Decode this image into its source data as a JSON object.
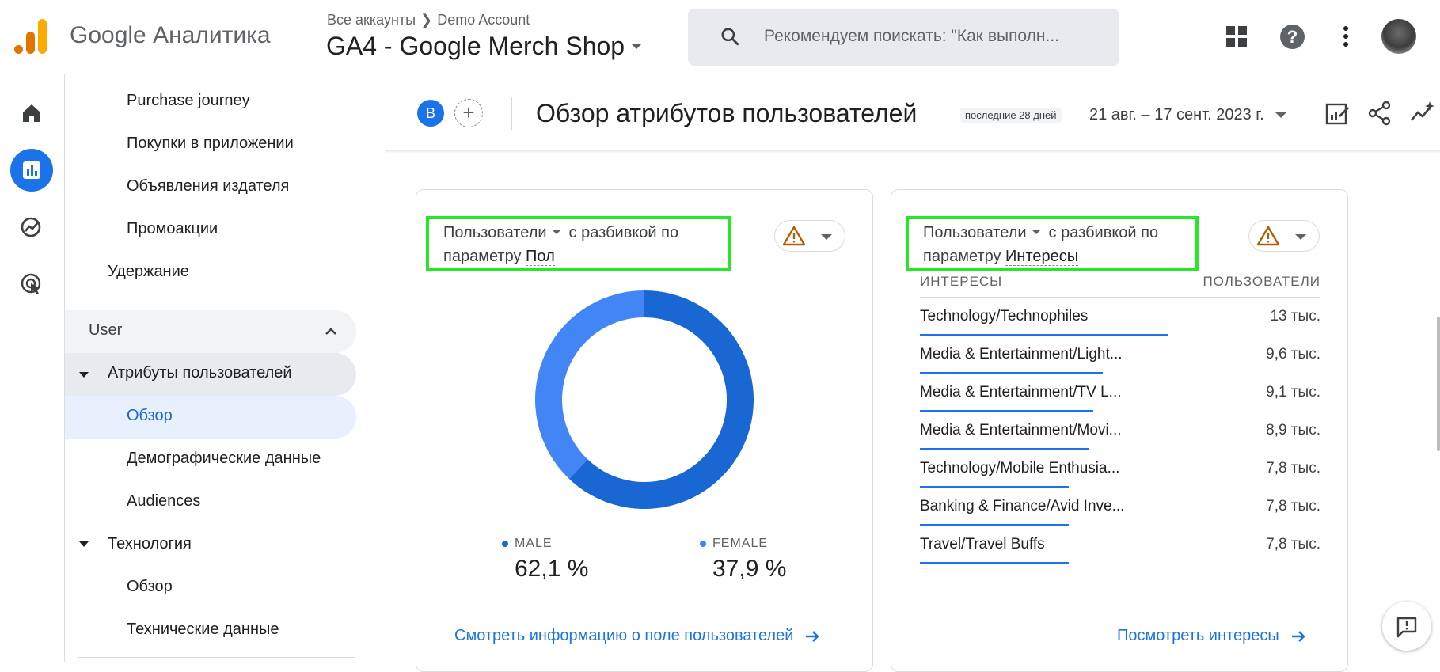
{
  "header": {
    "app_name": "Google Аналитика",
    "breadcrumb_root": "Все аккаунты",
    "breadcrumb_account": "Demo Account",
    "property_name": "GA4 - Google Merch Shop",
    "search_placeholder": "Рекомендуем поискать: \"Как выполн...",
    "icons": [
      "apps-icon",
      "help-icon",
      "more-vert-icon",
      "avatar"
    ]
  },
  "rail": {
    "items": [
      "home-icon",
      "reports-icon",
      "explore-icon",
      "advertising-icon"
    ],
    "active": "reports-icon"
  },
  "nav": {
    "items": [
      {
        "label": "Purchase journey"
      },
      {
        "label": "Покупки в приложении"
      },
      {
        "label": "Объявления издателя"
      },
      {
        "label": "Промоакции"
      },
      {
        "label": "Удержание"
      },
      {
        "label": "User"
      },
      {
        "label": "Атрибуты пользователей"
      },
      {
        "label": "Обзор"
      },
      {
        "label": "Демографические данные"
      },
      {
        "label": "Audiences"
      },
      {
        "label": "Технология"
      },
      {
        "label": "Обзор"
      },
      {
        "label": "Технические данные"
      }
    ],
    "active_item": "Обзор",
    "section_bg": "#e8eaed",
    "active_bg": "#e8f0fe"
  },
  "title_row": {
    "segment_badge": "B",
    "page_title": "Обзор атрибутов пользователей",
    "date_chip": "последние 28 дней",
    "date_range": "21 авг. – 17 сент. 2023 г.",
    "tools": [
      "customize-report-icon",
      "share-icon",
      "insights-icon"
    ]
  },
  "gender_card": {
    "metric": "Пользователи",
    "breakdown_text": "с разбивкой по",
    "param_prefix": "параметру",
    "dimension": "Пол",
    "segments": [
      {
        "label": "MALE",
        "value_text": "62,1 %",
        "share": 0.621,
        "color": "#1967d2"
      },
      {
        "label": "FEMALE",
        "value_text": "37,9 %",
        "share": 0.379,
        "color": "#4285f4"
      }
    ],
    "link": "Смотреть информацию о поле пользователей"
  },
  "interests_card": {
    "metric": "Пользователи",
    "breakdown_text": "с разбивкой по",
    "param_prefix": "параметру",
    "dimension": "Интересы",
    "col_left": "ИНТЕРЕСЫ",
    "col_right": "ПОЛЬЗОВАТЕЛИ",
    "rows": [
      {
        "name": "Technology/Technophiles",
        "value": "13 тыс.",
        "num": 13.0
      },
      {
        "name": "Media & Entertainment/Light...",
        "value": "9,6 тыс.",
        "num": 9.6
      },
      {
        "name": "Media & Entertainment/TV L...",
        "value": "9,1 тыс.",
        "num": 9.1
      },
      {
        "name": "Media & Entertainment/Movi...",
        "value": "8,9 тыс.",
        "num": 8.9
      },
      {
        "name": "Technology/Mobile Enthusia...",
        "value": "7,8 тыс.",
        "num": 7.8
      },
      {
        "name": "Banking & Finance/Avid Inve...",
        "value": "7,8 тыс.",
        "num": 7.8
      },
      {
        "name": "Travel/Travel Buffs",
        "value": "7,8 тыс.",
        "num": 7.8
      }
    ],
    "link": "Посмотреть интересы"
  },
  "colors": {
    "accent": "#1a73e8",
    "highlight_box": "#26e826",
    "warning": "#b06000"
  }
}
